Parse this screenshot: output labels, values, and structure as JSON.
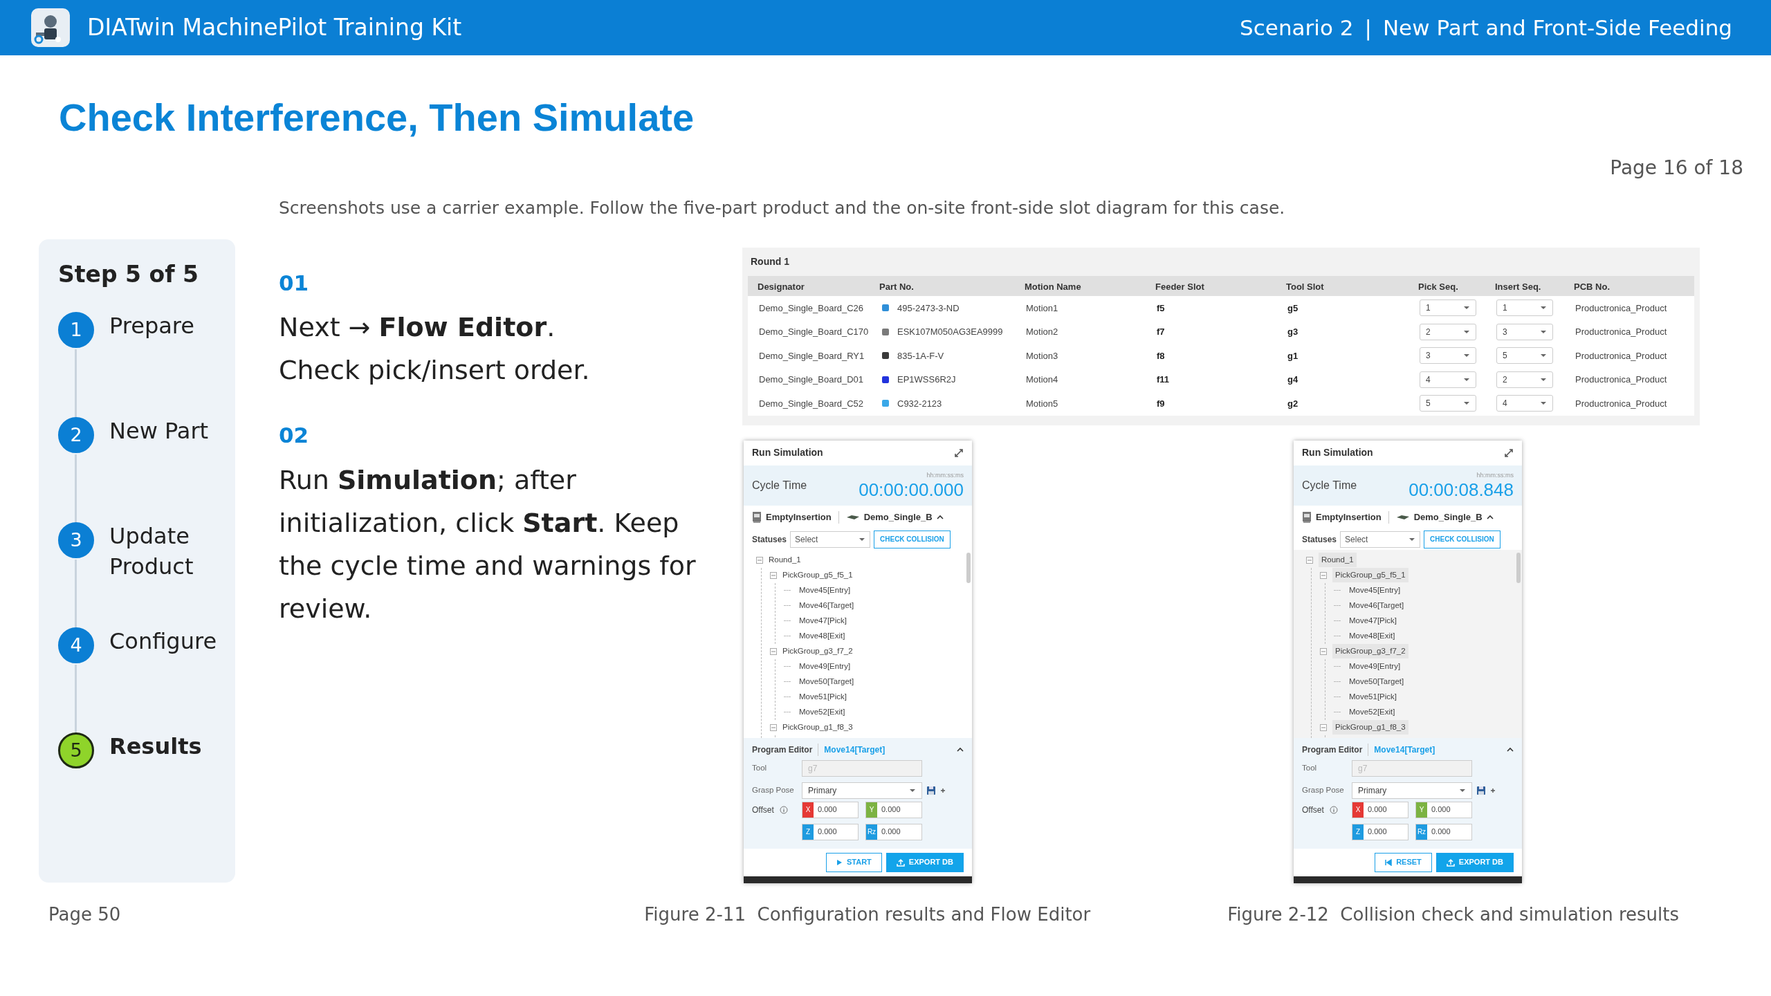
{
  "header": {
    "title": "DIATwin MachinePilot Training Kit",
    "scenario": "Scenario 2",
    "separator": "|",
    "section": "New Part and Front-Side Feeding"
  },
  "page_title": "Check Interference, Then Simulate",
  "page_counter": "Page 16 of 18",
  "intro": "Screenshots use a carrier example. Follow the five-part product and the on-site front-side slot diagram for this case.",
  "stepper": {
    "title": "Step 5 of 5",
    "steps": [
      {
        "number": "1",
        "label": "Prepare",
        "selected": false
      },
      {
        "number": "2",
        "label": "New Part",
        "selected": false
      },
      {
        "number": "3",
        "label": "Update Product",
        "selected": false
      },
      {
        "number": "4",
        "label": "Configure",
        "selected": false
      },
      {
        "number": "5",
        "label": "Results",
        "selected": true
      }
    ]
  },
  "instructions": [
    {
      "number": "01",
      "lines": [
        "Next → **Flow Editor**.",
        "Check pick/insert order."
      ]
    },
    {
      "number": "02",
      "lines": [
        "Run **Simulation**; after initialization, click **Start**. Keep the cycle time and warnings for review."
      ]
    }
  ],
  "table_screenshot": {
    "title": "Round 1",
    "columns": [
      "Designator",
      "Part No.",
      "Motion Name",
      "Feeder Slot",
      "Tool Slot",
      "Pick Seq.",
      "Insert Seq.",
      "PCB No."
    ],
    "rows": [
      {
        "designator": "Demo_Single_Board_C26",
        "part_no": "495-2473-3-ND",
        "color": "#2f8fd8",
        "motion": "Motion1",
        "feeder": "f5",
        "tool": "g5",
        "pick": "1",
        "insert": "1",
        "pcb": "Productronica_Product"
      },
      {
        "designator": "Demo_Single_Board_C170",
        "part_no": "ESK107M050AG3EA9999",
        "color": "#7a7a7a",
        "motion": "Motion2",
        "feeder": "f7",
        "tool": "g3",
        "pick": "2",
        "insert": "3",
        "pcb": "Productronica_Product"
      },
      {
        "designator": "Demo_Single_Board_RY1",
        "part_no": "835-1A-F-V",
        "color": "#3a3a3a",
        "motion": "Motion3",
        "feeder": "f8",
        "tool": "g1",
        "pick": "3",
        "insert": "5",
        "pcb": "Productronica_Product"
      },
      {
        "designator": "Demo_Single_Board_D01",
        "part_no": "EP1WSS6R2J",
        "color": "#2233dd",
        "motion": "Motion4",
        "feeder": "f11",
        "tool": "g4",
        "pick": "4",
        "insert": "2",
        "pcb": "Productronica_Product"
      },
      {
        "designator": "Demo_Single_Board_C52",
        "part_no": "C932-2123",
        "color": "#3aa8e8",
        "motion": "Motion5",
        "feeder": "f9",
        "tool": "g2",
        "pick": "5",
        "insert": "4",
        "pcb": "Productronica_Product"
      }
    ]
  },
  "simulations": [
    {
      "title": "Run Simulation",
      "cycle_label": "Cycle Time",
      "time_format": "hh:mm:ss:ms",
      "cycle_time": "00:00:00.000",
      "machine": "EmptyInsertion",
      "board": "Demo_Single_B",
      "statuses_label": "Statuses",
      "statuses_placeholder": "Select",
      "check_button": "CHECK COLLISION",
      "tree_highlighted": false,
      "tree": [
        {
          "label": "Round_1",
          "expanded": true,
          "children": [
            {
              "label": "PickGroup_g5_f5_1",
              "expanded": true,
              "children": [
                {
                  "label": "Move45[Entry]"
                },
                {
                  "label": "Move46[Target]"
                },
                {
                  "label": "Move47[Pick]"
                },
                {
                  "label": "Move48[Exit]"
                }
              ]
            },
            {
              "label": "PickGroup_g3_f7_2",
              "expanded": true,
              "children": [
                {
                  "label": "Move49[Entry]"
                },
                {
                  "label": "Move50[Target]"
                },
                {
                  "label": "Move51[Pick]"
                },
                {
                  "label": "Move52[Exit]"
                }
              ]
            },
            {
              "label": "PickGroup_g1_f8_3",
              "expanded": true
            }
          ]
        }
      ],
      "editor_label": "Program Editor",
      "editor_target": "Move14[Target]",
      "tool_label": "Tool",
      "tool_value": "g7",
      "grasp_label": "Grasp Pose",
      "grasp_value": "Primary",
      "offset_label": "Offset",
      "offsets": [
        {
          "axis": "X",
          "value": "0.000",
          "color": "#e53935"
        },
        {
          "axis": "Y",
          "value": "0.000",
          "color": "#7cb342"
        },
        {
          "axis": "Z",
          "value": "0.000",
          "color": "#1e9be0"
        },
        {
          "axis": "Rz",
          "value": "0.000",
          "color": "#1e9be0"
        }
      ],
      "buttons": [
        {
          "kind": "start",
          "label": "START"
        },
        {
          "kind": "export",
          "label": "EXPORT DB"
        }
      ]
    },
    {
      "title": "Run Simulation",
      "cycle_label": "Cycle Time",
      "time_format": "hh:mm:ss:ms",
      "cycle_time": "00:00:08.848",
      "machine": "EmptyInsertion",
      "board": "Demo_Single_B",
      "statuses_label": "Statuses",
      "statuses_placeholder": "Select",
      "check_button": "CHECK COLLISION",
      "tree_highlighted": true,
      "tree": [
        {
          "label": "Round_1",
          "expanded": true,
          "children": [
            {
              "label": "PickGroup_g5_f5_1",
              "expanded": true,
              "children": [
                {
                  "label": "Move45[Entry]"
                },
                {
                  "label": "Move46[Target]"
                },
                {
                  "label": "Move47[Pick]"
                },
                {
                  "label": "Move48[Exit]"
                }
              ]
            },
            {
              "label": "PickGroup_g3_f7_2",
              "expanded": true,
              "children": [
                {
                  "label": "Move49[Entry]"
                },
                {
                  "label": "Move50[Target]"
                },
                {
                  "label": "Move51[Pick]"
                },
                {
                  "label": "Move52[Exit]"
                }
              ]
            },
            {
              "label": "PickGroup_g1_f8_3",
              "expanded": true
            }
          ]
        }
      ],
      "editor_label": "Program Editor",
      "editor_target": "Move14[Target]",
      "tool_label": "Tool",
      "tool_value": "g7",
      "grasp_label": "Grasp Pose",
      "grasp_value": "Primary",
      "offset_label": "Offset",
      "offsets": [
        {
          "axis": "X",
          "value": "0.000",
          "color": "#e53935"
        },
        {
          "axis": "Y",
          "value": "0.000",
          "color": "#7cb342"
        },
        {
          "axis": "Z",
          "value": "0.000",
          "color": "#1e9be0"
        },
        {
          "axis": "Rz",
          "value": "0.000",
          "color": "#1e9be0"
        }
      ],
      "buttons": [
        {
          "kind": "reset",
          "label": "RESET"
        },
        {
          "kind": "export",
          "label": "EXPORT DB"
        }
      ]
    }
  ],
  "footer": {
    "page": "Page 50",
    "captions": [
      "Figure 2-11  Configuration results and Flow Editor",
      "Figure 2-12  Collision check and simulation results"
    ]
  }
}
